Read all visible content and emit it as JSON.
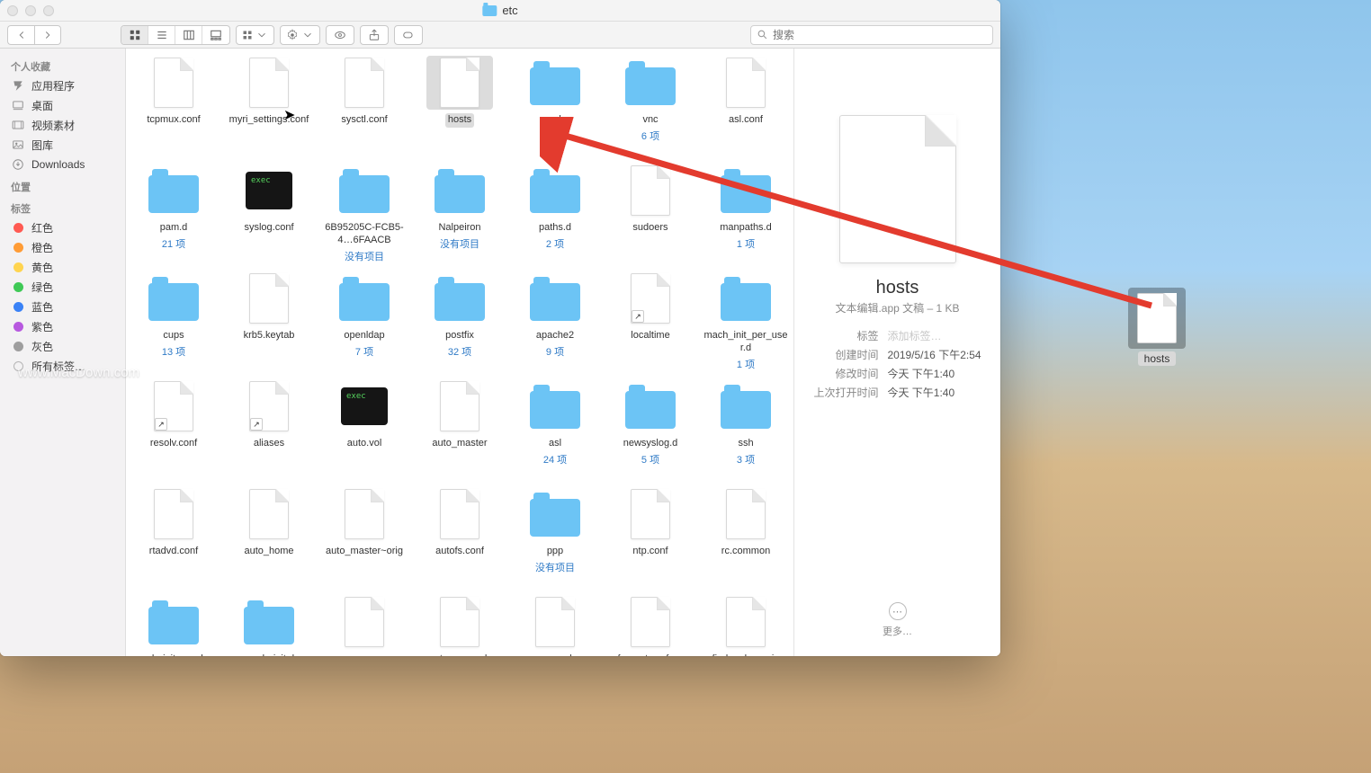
{
  "window": {
    "title": "etc"
  },
  "toolbar": {
    "search_placeholder": "搜索"
  },
  "sidebar": {
    "sections": [
      {
        "header": "个人收藏",
        "items": [
          {
            "icon": "apps",
            "label": "应用程序"
          },
          {
            "icon": "desk",
            "label": "桌面"
          },
          {
            "icon": "vids",
            "label": "视频素材"
          },
          {
            "icon": "pics",
            "label": "图库"
          },
          {
            "icon": "dl",
            "label": "Downloads"
          }
        ]
      },
      {
        "header": "位置",
        "items": []
      },
      {
        "header": "标签",
        "items": [
          {
            "color": "#ff5a52",
            "label": "红色"
          },
          {
            "color": "#ff9c36",
            "label": "橙色"
          },
          {
            "color": "#ffd44f",
            "label": "黄色"
          },
          {
            "color": "#3fc956",
            "label": "绿色"
          },
          {
            "color": "#3a82f6",
            "label": "蓝色"
          },
          {
            "color": "#b759df",
            "label": "紫色"
          },
          {
            "color": "#9e9e9e",
            "label": "灰色"
          },
          {
            "open": true,
            "label": "所有标签…"
          }
        ]
      }
    ]
  },
  "files": [
    {
      "name": "tcpmux.conf",
      "kind": "file"
    },
    {
      "name": "myri_settings.conf",
      "kind": "file"
    },
    {
      "name": "sysctl.conf",
      "kind": "file"
    },
    {
      "name": "hosts",
      "kind": "file",
      "selected": true
    },
    {
      "name": "ssl",
      "kind": "folder",
      "sub": "4 项"
    },
    {
      "name": "vnc",
      "kind": "folder",
      "sub": "6 项"
    },
    {
      "name": "asl.conf",
      "kind": "file"
    },
    {
      "name": "pam.d",
      "kind": "folder",
      "sub": "21 项"
    },
    {
      "name": "syslog.conf",
      "kind": "exec"
    },
    {
      "name": "6B95205C-FCB5-4…6FAACB",
      "kind": "folder",
      "sub": "没有项目"
    },
    {
      "name": "Nalpeiron",
      "kind": "folder",
      "sub": "没有项目"
    },
    {
      "name": "paths.d",
      "kind": "folder",
      "sub": "2 项"
    },
    {
      "name": "sudoers",
      "kind": "file"
    },
    {
      "name": "manpaths.d",
      "kind": "folder",
      "sub": "1 项"
    },
    {
      "name": "cups",
      "kind": "folder",
      "sub": "13 项"
    },
    {
      "name": "krb5.keytab",
      "kind": "file"
    },
    {
      "name": "openldap",
      "kind": "folder",
      "sub": "7 项"
    },
    {
      "name": "postfix",
      "kind": "folder",
      "sub": "32 项"
    },
    {
      "name": "apache2",
      "kind": "folder",
      "sub": "9 项"
    },
    {
      "name": "localtime",
      "kind": "file",
      "alias": true
    },
    {
      "name": "mach_init_per_user.d",
      "kind": "folder",
      "sub": "1 项"
    },
    {
      "name": "resolv.conf",
      "kind": "file",
      "alias": true
    },
    {
      "name": "aliases",
      "kind": "file",
      "alias": true
    },
    {
      "name": "auto.vol",
      "kind": "exec"
    },
    {
      "name": "auto_master",
      "kind": "file"
    },
    {
      "name": "asl",
      "kind": "folder",
      "sub": "24 项"
    },
    {
      "name": "newsyslog.d",
      "kind": "folder",
      "sub": "5 项"
    },
    {
      "name": "ssh",
      "kind": "folder",
      "sub": "3 项"
    },
    {
      "name": "rtadvd.conf",
      "kind": "file"
    },
    {
      "name": "auto_home",
      "kind": "file"
    },
    {
      "name": "auto_master~orig",
      "kind": "file"
    },
    {
      "name": "autofs.conf",
      "kind": "file"
    },
    {
      "name": "ppp",
      "kind": "folder",
      "sub": "没有项目"
    },
    {
      "name": "ntp.conf",
      "kind": "file"
    },
    {
      "name": "rc.common",
      "kind": "file"
    },
    {
      "name": "mach_init_per_log",
      "kind": "folder"
    },
    {
      "name": "mach_init.d",
      "kind": "folder"
    },
    {
      "name": "group",
      "kind": "file"
    },
    {
      "name": "master.passwd~o",
      "kind": "file"
    },
    {
      "name": "passwd",
      "kind": "file"
    },
    {
      "name": "afpovertcp.cfg~or",
      "kind": "file"
    },
    {
      "name": "find.codes~orig",
      "kind": "file"
    }
  ],
  "preview": {
    "name": "hosts",
    "kind": "文本编辑.app 文稿 – 1 KB",
    "meta": [
      {
        "k": "标签",
        "v": "添加标签…",
        "ph": true
      },
      {
        "k": "创建时间",
        "v": "2019/5/16 下午2:54"
      },
      {
        "k": "修改时间",
        "v": "今天 下午1:40"
      },
      {
        "k": "上次打开时间",
        "v": "今天 下午1:40"
      }
    ],
    "more": "更多…"
  },
  "desktop": {
    "name": "hosts"
  },
  "watermark": "www.MacDown.com"
}
